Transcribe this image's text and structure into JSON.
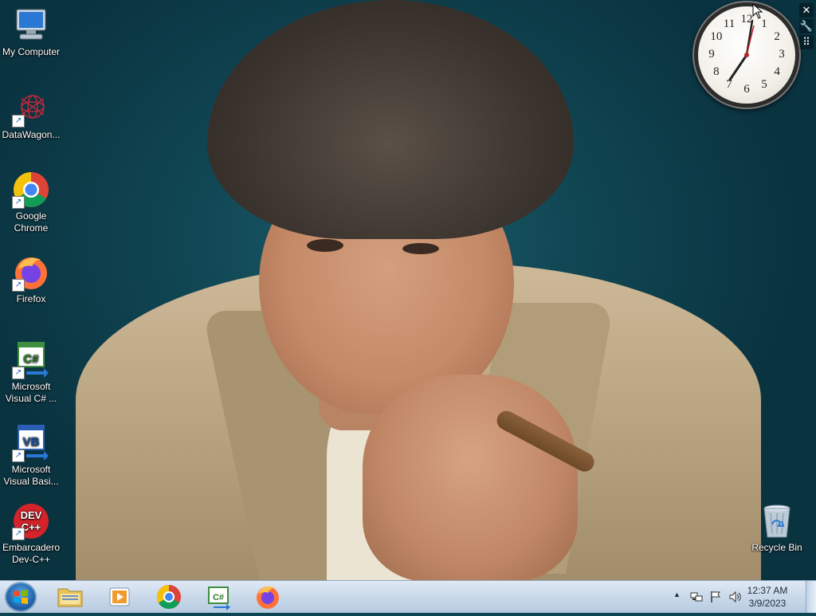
{
  "desktop_icons": [
    {
      "label": "My Computer",
      "icon": "computer-icon"
    },
    {
      "label": "DataWagon...",
      "icon": "datawagon-icon"
    },
    {
      "label": "Google Chrome",
      "icon": "chrome-icon"
    },
    {
      "label": "Firefox",
      "icon": "firefox-icon"
    },
    {
      "label": "Microsoft Visual C# ...",
      "icon": "visual-csharp-icon"
    },
    {
      "label": "Microsoft Visual Basi...",
      "icon": "visual-basic-icon"
    },
    {
      "label": "Embarcadero Dev-C++",
      "icon": "devcpp-icon"
    },
    {
      "label": "Recycle Bin",
      "icon": "recycle-bin-icon"
    }
  ],
  "gadget": {
    "clock_numbers": [
      "12",
      "1",
      "2",
      "3",
      "4",
      "5",
      "6",
      "7",
      "8",
      "9",
      "10",
      "11"
    ],
    "close_glyph": "✕",
    "settings_glyph": "🔧",
    "drag_glyph": "⠿"
  },
  "taskbar": {
    "items": [
      {
        "name": "file-explorer",
        "icon": "folder-icon"
      },
      {
        "name": "media-player",
        "icon": "media-player-icon"
      },
      {
        "name": "chrome",
        "icon": "chrome-icon"
      },
      {
        "name": "visual-csharp",
        "icon": "visual-csharp-icon"
      },
      {
        "name": "firefox",
        "icon": "firefox-icon"
      }
    ],
    "time": "12:37 AM",
    "date": "3/9/2023",
    "tray_arrow": "▲"
  },
  "colors": {
    "desktop_bg": "#0d4552",
    "taskbar_top": "#dfe9f5",
    "chrome_red": "#db4437",
    "chrome_yellow": "#f4c20d",
    "chrome_green": "#0f9d58",
    "chrome_blue": "#4285f4",
    "firefox_orange": "#ff7139",
    "devcpp_red": "#d4232a"
  }
}
